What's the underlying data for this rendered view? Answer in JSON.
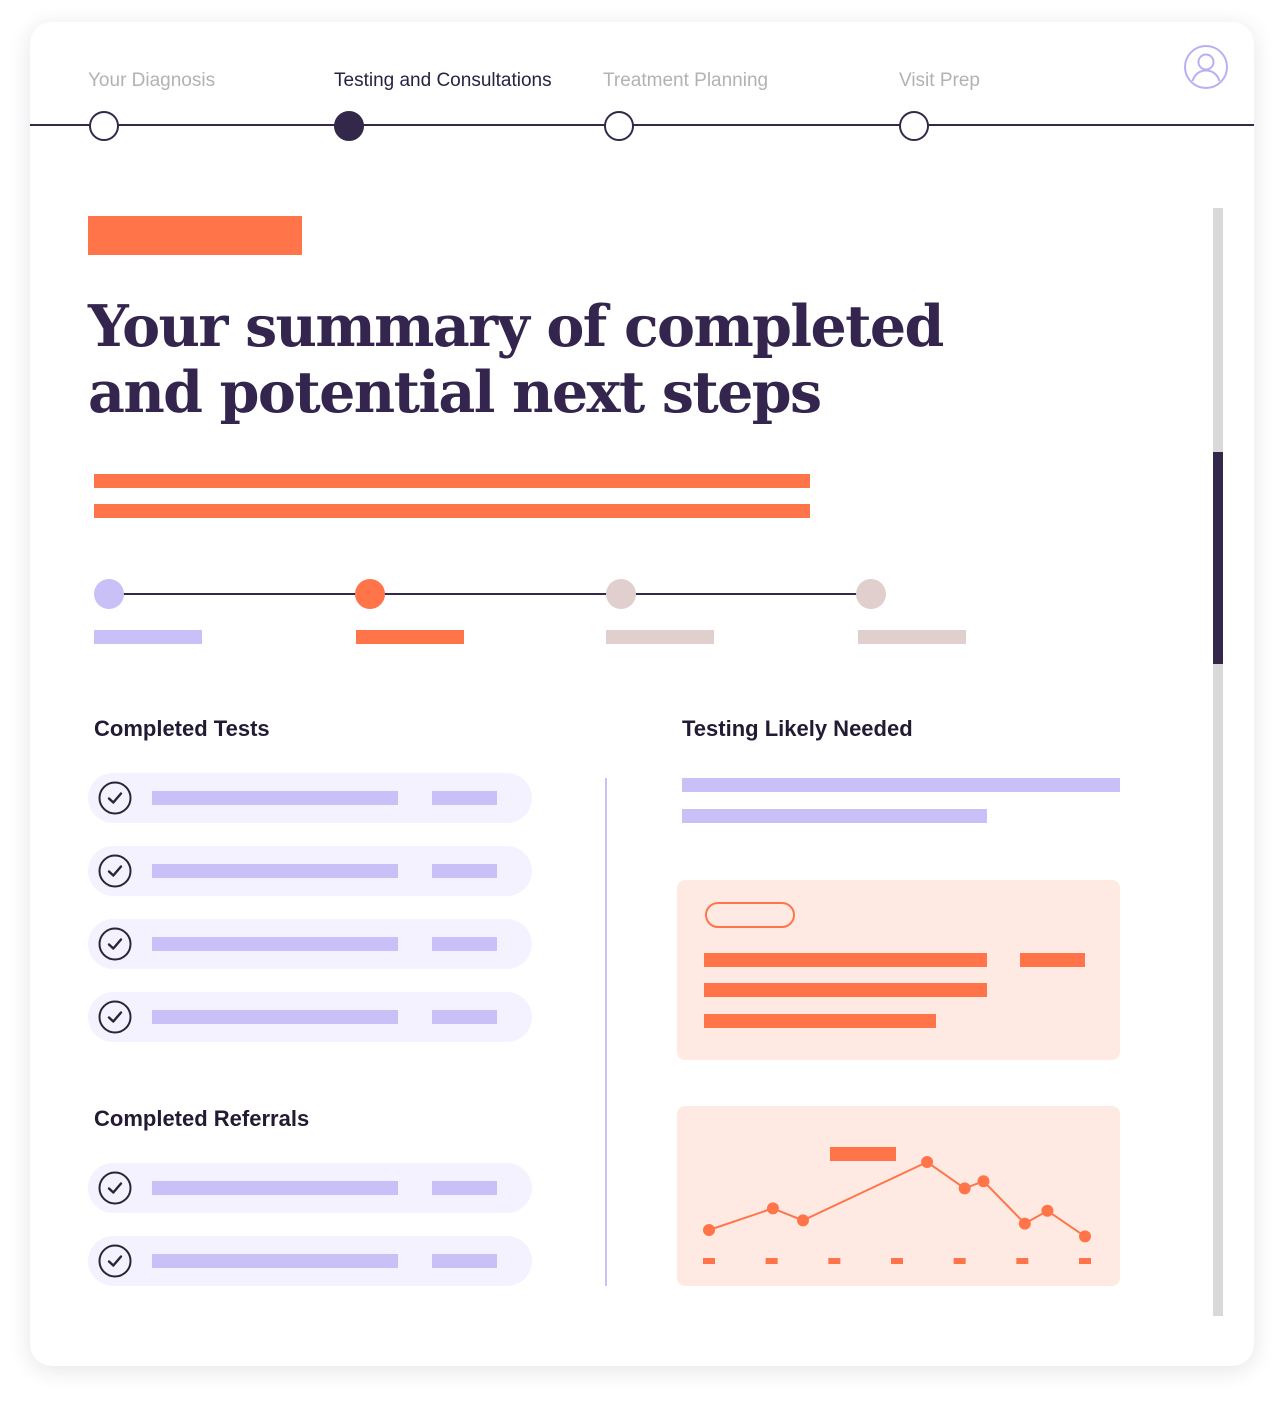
{
  "steps": [
    {
      "label": "Your Diagnosis",
      "state": "complete"
    },
    {
      "label": "Testing and Consultations",
      "state": "active"
    },
    {
      "label": "Treatment Planning",
      "state": "upcoming"
    },
    {
      "label": "Visit Prep",
      "state": "upcoming"
    }
  ],
  "profile": {
    "icon": "user-avatar-icon"
  },
  "page_title": "Your summary of completed and potential next steps",
  "progress": {
    "dots": [
      {
        "color": "#c8c0f7"
      },
      {
        "color": "#ff7549"
      },
      {
        "color": "#e0cfcd"
      },
      {
        "color": "#e0cfcd"
      }
    ]
  },
  "completed_tests": {
    "title": "Completed Tests",
    "items": 4,
    "icon": "check-circle-icon"
  },
  "completed_referrals": {
    "title": "Completed Referrals",
    "items": 2,
    "icon": "check-circle-icon"
  },
  "testing_needed": {
    "title": "Testing Likely Needed"
  },
  "colors": {
    "accent_orange": "#ff7549",
    "lavender": "#c8c0f7",
    "navy": "#33284a",
    "panel_bg": "#ffeae3"
  },
  "chart_data": {
    "type": "line",
    "x": [
      1,
      2,
      3,
      4,
      5,
      6,
      7,
      8,
      9,
      10,
      11
    ],
    "values": [
      0.15,
      0.42,
      0.27,
      1.0,
      0.67,
      0.76,
      0.23,
      0.39,
      0.07
    ],
    "x_positions": [
      0.0,
      0.17,
      0.25,
      0.58,
      0.68,
      0.73,
      0.84,
      0.9,
      1.0
    ],
    "ticks": 7
  }
}
